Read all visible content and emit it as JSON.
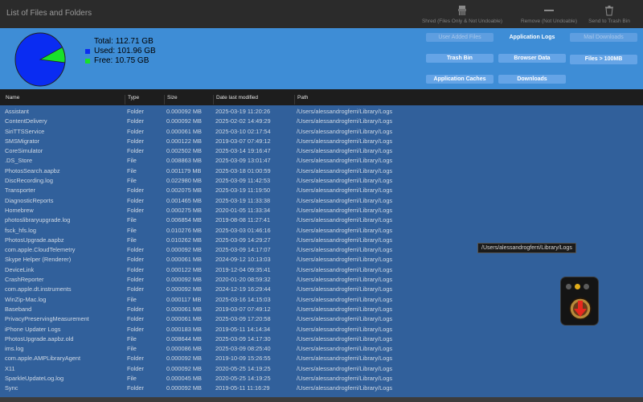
{
  "window": {
    "title": "List of Files and Folders"
  },
  "toolbar": {
    "shred": {
      "icon": "shredder-icon",
      "label": "Shred (Files Only & Not Undoable)"
    },
    "remove": {
      "icon": "minus-icon",
      "label": "Remove (Not Undoable)"
    },
    "trash": {
      "icon": "trash-bin-icon",
      "label": "Send to Trash Bin"
    }
  },
  "summary": {
    "total_label": "Total:",
    "total_value": "112.71 GB",
    "used_label": "Used:",
    "used_value": "101.96 GB",
    "free_label": "Free:",
    "free_value": "10.75 GB",
    "used_color": "#0a2cf2",
    "free_color": "#18e02a",
    "used_fraction": 0.9046
  },
  "filters": {
    "user_added_files": "User Added Files",
    "application_logs": "Application Logs",
    "mail_downloads": "Mail Downloads",
    "trash_bin": "Trash Bin",
    "browser_data": "Browser Data",
    "files_over_100mb": "Files > 100MB",
    "application_caches": "Application Caches",
    "downloads": "Downloads"
  },
  "table": {
    "headers": {
      "name": "Name",
      "type": "Type",
      "size": "Size",
      "date": "Date last modified",
      "path": "Path"
    },
    "rows": [
      {
        "name": "Assistant",
        "type": "Folder",
        "size": "0.000092 MB",
        "date": "2025-03-19 11:20:26",
        "path": "/Users/alessandrogferri/Library/Logs"
      },
      {
        "name": "ContentDelivery",
        "type": "Folder",
        "size": "0.000092 MB",
        "date": "2025-02-02 14:49:29",
        "path": "/Users/alessandrogferri/Library/Logs"
      },
      {
        "name": "SiriTTSService",
        "type": "Folder",
        "size": "0.000061 MB",
        "date": "2025-03-10 02:17:54",
        "path": "/Users/alessandrogferri/Library/Logs"
      },
      {
        "name": "SMSMigrator",
        "type": "Folder",
        "size": "0.000122 MB",
        "date": "2019-03-07 07:49:12",
        "path": "/Users/alessandrogferri/Library/Logs"
      },
      {
        "name": "CoreSimulator",
        "type": "Folder",
        "size": "0.002502 MB",
        "date": "2025-03-14 19:16:47",
        "path": "/Users/alessandrogferri/Library/Logs"
      },
      {
        "name": ".DS_Store",
        "type": "File",
        "size": "0.008863 MB",
        "date": "2025-03-09 13:01:47",
        "path": "/Users/alessandrogferri/Library/Logs"
      },
      {
        "name": "PhotosSearch.aapbz",
        "type": "File",
        "size": "0.001179 MB",
        "date": "2025-03-18 01:00:59",
        "path": "/Users/alessandrogferri/Library/Logs"
      },
      {
        "name": "DiscRecording.log",
        "type": "File",
        "size": "0.022980 MB",
        "date": "2025-03-09 11:42:53",
        "path": "/Users/alessandrogferri/Library/Logs"
      },
      {
        "name": "Transporter",
        "type": "Folder",
        "size": "0.002075 MB",
        "date": "2025-03-19 11:19:50",
        "path": "/Users/alessandrogferri/Library/Logs"
      },
      {
        "name": "DiagnosticReports",
        "type": "Folder",
        "size": "0.001465 MB",
        "date": "2025-03-19 11:33:38",
        "path": "/Users/alessandrogferri/Library/Logs"
      },
      {
        "name": "Homebrew",
        "type": "Folder",
        "size": "0.000275 MB",
        "date": "2020-01-05 11:33:34",
        "path": "/Users/alessandrogferri/Library/Logs"
      },
      {
        "name": "photoslibraryupgrade.log",
        "type": "File",
        "size": "0.006854 MB",
        "date": "2019-08-08 11:27:41",
        "path": "/Users/alessandrogferri/Library/Logs"
      },
      {
        "name": "fsck_hfs.log",
        "type": "File",
        "size": "0.010276 MB",
        "date": "2025-03-03 01:46:16",
        "path": "/Users/alessandrogferri/Library/Logs"
      },
      {
        "name": "PhotosUpgrade.aapbz",
        "type": "File",
        "size": "0.010262 MB",
        "date": "2025-03-09 14:29:27",
        "path": "/Users/alessandrogferri/Library/Logs"
      },
      {
        "name": "com.apple.CloudTelemetry",
        "type": "Folder",
        "size": "0.000092 MB",
        "date": "2025-03-09 14:17:07",
        "path": "/Users/alessandrogferri/Library/Logs"
      },
      {
        "name": "Skype Helper (Renderer)",
        "type": "Folder",
        "size": "0.000061 MB",
        "date": "2024-09-12 10:13:03",
        "path": "/Users/alessandrogferri/Library/Logs"
      },
      {
        "name": "DeviceLink",
        "type": "Folder",
        "size": "0.000122 MB",
        "date": "2019-12-04 09:35:41",
        "path": "/Users/alessandrogferri/Library/Logs"
      },
      {
        "name": "CrashReporter",
        "type": "Folder",
        "size": "0.000092 MB",
        "date": "2020-01-20 08:59:32",
        "path": "/Users/alessandrogferri/Library/Logs"
      },
      {
        "name": "com.apple.dt.instruments",
        "type": "Folder",
        "size": "0.000092 MB",
        "date": "2024-12-19 16:29:44",
        "path": "/Users/alessandrogferri/Library/Logs"
      },
      {
        "name": "WinZip-Mac.log",
        "type": "File",
        "size": "0.000117 MB",
        "date": "2025-03-16 14:15:03",
        "path": "/Users/alessandrogferri/Library/Logs"
      },
      {
        "name": "Baseband",
        "type": "Folder",
        "size": "0.000061 MB",
        "date": "2019-03-07 07:49:12",
        "path": "/Users/alessandrogferri/Library/Logs"
      },
      {
        "name": "PrivacyPreservingMeasurement",
        "type": "Folder",
        "size": "0.000061 MB",
        "date": "2025-03-09 17:20:58",
        "path": "/Users/alessandrogferri/Library/Logs"
      },
      {
        "name": "iPhone Updater Logs",
        "type": "Folder",
        "size": "0.000183 MB",
        "date": "2019-05-11 14:14:34",
        "path": "/Users/alessandrogferri/Library/Logs"
      },
      {
        "name": "PhotosUpgrade.aapbz.old",
        "type": "File",
        "size": "0.008644 MB",
        "date": "2025-03-09 14:17:30",
        "path": "/Users/alessandrogferri/Library/Logs"
      },
      {
        "name": "ims.log",
        "type": "File",
        "size": "0.000086 MB",
        "date": "2025-03-09 08:25:40",
        "path": "/Users/alessandrogferri/Library/Logs"
      },
      {
        "name": "com.apple.AMPLibraryAgent",
        "type": "Folder",
        "size": "0.000092 MB",
        "date": "2019-10-09 15:26:55",
        "path": "/Users/alessandrogferri/Library/Logs"
      },
      {
        "name": "X11",
        "type": "Folder",
        "size": "0.000092 MB",
        "date": "2020-05-25 14:19:25",
        "path": "/Users/alessandrogferri/Library/Logs"
      },
      {
        "name": "SparkleUpdateLog.log",
        "type": "File",
        "size": "0.000045 MB",
        "date": "2020-05-25 14:19:25",
        "path": "/Users/alessandrogferri/Library/Logs"
      },
      {
        "name": "Sync",
        "type": "Folder",
        "size": "0.000092 MB",
        "date": "2019-05-11 11:16:29",
        "path": "/Users/alessandrogferri/Library/Logs"
      }
    ]
  },
  "tooltip": "/Users/alessandrogferri/Library/Logs"
}
